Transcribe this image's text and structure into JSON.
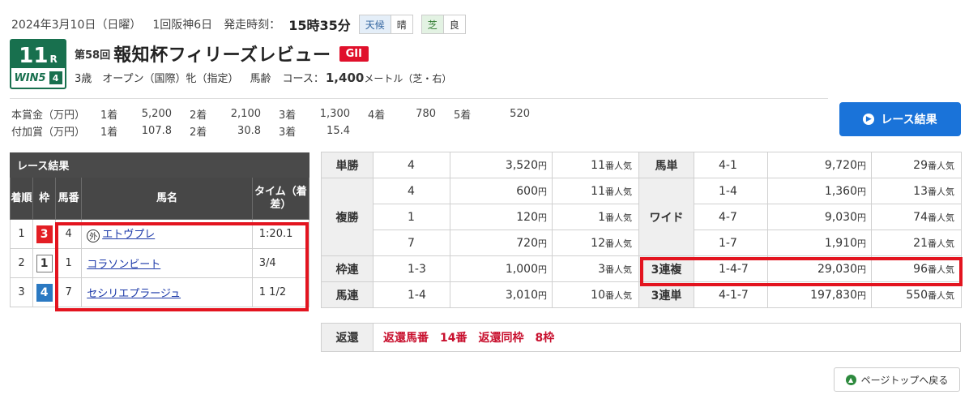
{
  "header": {
    "date": "2024年3月10日（日曜）",
    "meeting": "1回阪神6日",
    "start_label": "発走時刻：",
    "start_time": "15時35分",
    "weather_label": "天候",
    "weather_value": "晴",
    "track_label": "芝",
    "track_value": "良"
  },
  "race": {
    "number": "11",
    "r_suffix": "R",
    "win5_label": "WIN5",
    "win5_number": "4",
    "edition": "第58回",
    "name": "報知杯フィリーズレビュー",
    "grade": "GII",
    "conditions": "3歳　オープン（国際）牝（指定）",
    "age_label": "馬齢",
    "course_label": "コース：",
    "distance": "1,400",
    "distance_unit": "メートル（芝・右）"
  },
  "prize": {
    "rows": [
      {
        "label": "本賞金（万円）",
        "cells": [
          "1着",
          "5,200",
          "2着",
          "2,100",
          "3着",
          "1,300",
          "4着",
          "780",
          "5着",
          "520"
        ]
      },
      {
        "label": "付加賞（万円）",
        "cells": [
          "1着",
          "107.8",
          "2着",
          "30.8",
          "3着",
          "15.4",
          "",
          "",
          "",
          ""
        ]
      }
    ]
  },
  "result_button": "レース結果",
  "results": {
    "caption": "レース結果",
    "headers": {
      "pos": "着順",
      "waku": "枠",
      "num": "馬番",
      "horse": "馬名",
      "time": "タイム（着差）"
    },
    "foreign_mark": "外",
    "rows": [
      {
        "pos": "1",
        "waku": "3",
        "num": "4",
        "horse": "エトヴプレ",
        "time": "1:20.1"
      },
      {
        "pos": "2",
        "waku": "1",
        "num": "1",
        "horse": "コラソンビート",
        "time": "3/4"
      },
      {
        "pos": "3",
        "waku": "4",
        "num": "7",
        "horse": "セシリエプラージュ",
        "time": "1 1/2"
      }
    ]
  },
  "payouts": {
    "yen": "円",
    "pop_suffix": "番人気",
    "tansho": {
      "label": "単勝",
      "rows": [
        {
          "combo": "4",
          "amount": "3,520",
          "pop": "11"
        }
      ]
    },
    "fukusho": {
      "label": "複勝",
      "rows": [
        {
          "combo": "4",
          "amount": "600",
          "pop": "11"
        },
        {
          "combo": "1",
          "amount": "120",
          "pop": "1"
        },
        {
          "combo": "7",
          "amount": "720",
          "pop": "12"
        }
      ]
    },
    "wakuren": {
      "label": "枠連",
      "rows": [
        {
          "combo": "1-3",
          "amount": "1,000",
          "pop": "3"
        }
      ]
    },
    "umaren": {
      "label": "馬連",
      "rows": [
        {
          "combo": "1-4",
          "amount": "3,010",
          "pop": "10"
        }
      ]
    },
    "umatan": {
      "label": "馬単",
      "rows": [
        {
          "combo": "4-1",
          "amount": "9,720",
          "pop": "29"
        }
      ]
    },
    "wide": {
      "label": "ワイド",
      "rows": [
        {
          "combo": "1-4",
          "amount": "1,360",
          "pop": "13"
        },
        {
          "combo": "4-7",
          "amount": "9,030",
          "pop": "74"
        },
        {
          "combo": "1-7",
          "amount": "1,910",
          "pop": "21"
        }
      ]
    },
    "sanrenpuku": {
      "label": "3連複",
      "rows": [
        {
          "combo": "1-4-7",
          "amount": "29,030",
          "pop": "96"
        }
      ]
    },
    "sanrentan": {
      "label": "3連単",
      "rows": [
        {
          "combo": "4-1-7",
          "amount": "197,830",
          "pop": "550"
        }
      ]
    }
  },
  "refund": {
    "label": "返還",
    "item1": "返還馬番　14番",
    "item2": "返還同枠　8枠"
  },
  "page_top": "ページトップへ戻る",
  "colors": {
    "accent": "#1a73d9",
    "highlight": "#e3141f",
    "grade": "#e0102b",
    "badge": "#18704e"
  }
}
